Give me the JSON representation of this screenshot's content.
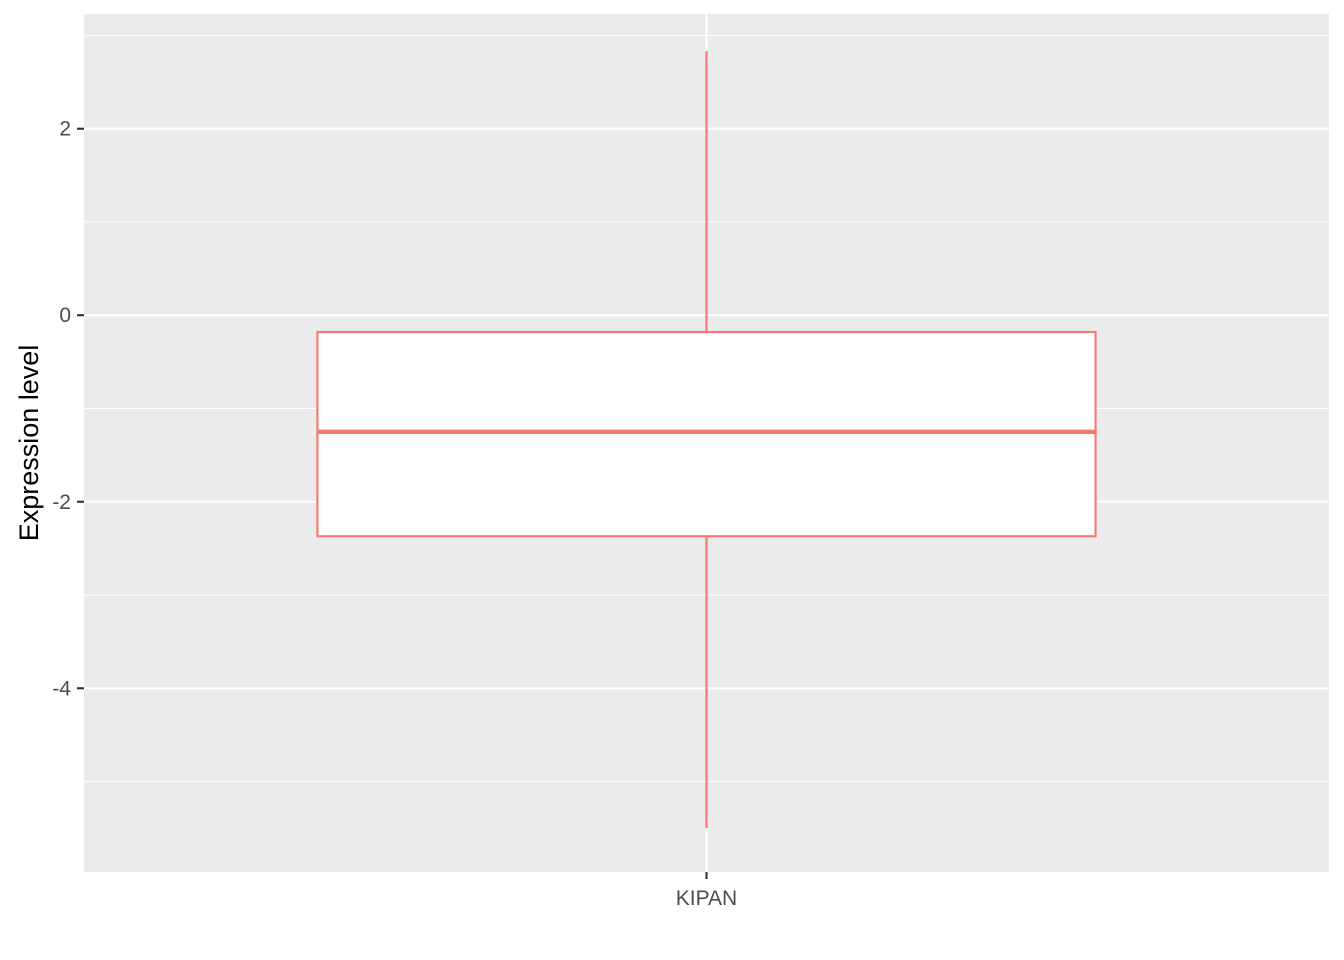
{
  "chart_data": {
    "type": "box",
    "title": "",
    "xlabel": "",
    "ylabel": "Expression level",
    "categories": [
      "KIPAN"
    ],
    "boxes": [
      {
        "category": "KIPAN",
        "whisker_low": -5.5,
        "q1": -2.37,
        "median": -1.25,
        "q3": -0.18,
        "whisker_high": 2.83
      }
    ],
    "yticks": [
      2,
      0,
      -2,
      -4
    ],
    "ytick_labels": [
      "2",
      "0",
      "-2",
      "-4"
    ],
    "ylim": [
      -5.97,
      3.23
    ],
    "grid": true,
    "colors": {
      "panel_background": "#ebebeb",
      "grid": "#ffffff",
      "box_outline": "#f8766d",
      "box_fill": "#ffffff",
      "tick_text": "#4d4d4d",
      "axis_title": "#000000"
    }
  }
}
